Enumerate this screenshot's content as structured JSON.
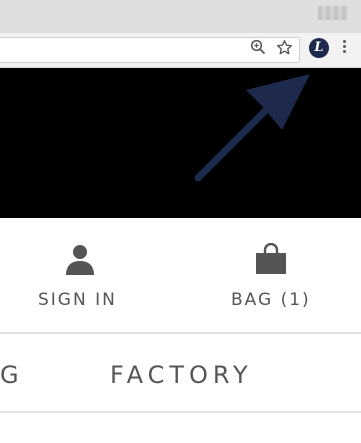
{
  "browser": {
    "icons": {
      "zoom": "zoom-icon",
      "bookmark": "star-icon",
      "extension": "extension-icon",
      "menu": "kebab-menu-icon"
    },
    "extension_letter": "L",
    "extension_color": "#1e2a4d"
  },
  "banner": {
    "background": "#000000",
    "arrow_color": "#1e2a4d"
  },
  "account_nav": {
    "sign_in_label": "SIGN IN",
    "bag_label": "BAG (1)",
    "sign_in_icon": "person-icon",
    "bag_icon": "shopping-bag-icon"
  },
  "menu": {
    "partial_item": "G",
    "factory_item": "FACTORY"
  }
}
